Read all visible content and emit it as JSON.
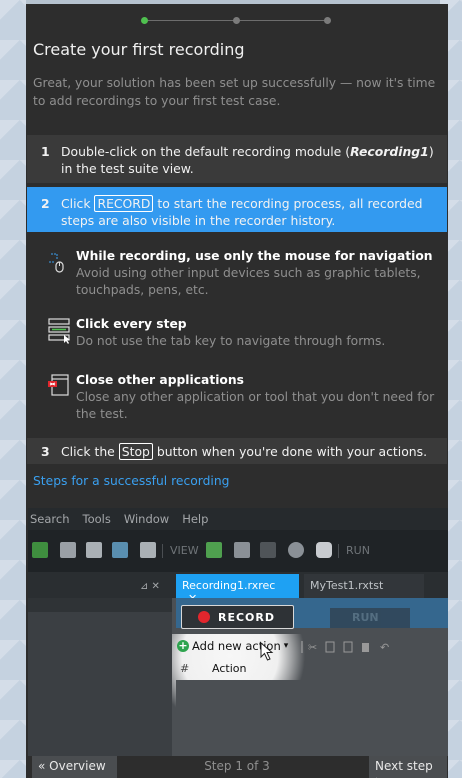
{
  "header": {
    "title": "Create your first recording",
    "intro": "Great, your solution has been set up successfully — now it's time to add recordings to your first test case."
  },
  "steps": [
    {
      "num": "1",
      "pre": "Double-click on the default recording module (",
      "em": "Recording1",
      "post": ") in the test suite view."
    },
    {
      "num": "2",
      "pre": "Click ",
      "key": "RECORD",
      "post": " to start the recording process, all recorded steps are also visible in the recorder history."
    },
    {
      "num": "3",
      "pre": "Click the ",
      "key": "Stop",
      "post": " button when you're done with your actions."
    }
  ],
  "tips": [
    {
      "title": "While recording, use only the mouse for navigation",
      "text": "Avoid using other input devices such as graphic tablets, touchpads, pens, etc.",
      "icon": "mouse-icon"
    },
    {
      "title": "Click every step",
      "text": "Do not use the tab key to navigate through forms.",
      "icon": "form-click-icon"
    },
    {
      "title": "Close other applications",
      "text": "Close any other application or tool that you don't need for the test.",
      "icon": "close-window-icon"
    }
  ],
  "link": "Steps for a successful recording",
  "screenshot": {
    "menu": [
      "Search",
      "Tools",
      "Window",
      "Help"
    ],
    "toolbar_view": "VIEW",
    "toolbar_run": "RUN",
    "tab_active": "Recording1.rxrec",
    "tab_close": "✕",
    "tab_inactive": "MyTest1.rxtst",
    "pin": "⊿ ✕",
    "record": "RECORD",
    "run_btn": "RUN",
    "add_action": "Add new action",
    "col_hash": "#",
    "col_action": "Action"
  },
  "footer": {
    "prev": "« Overview",
    "step": "Step 1 of 3",
    "next": "Next step ›"
  }
}
